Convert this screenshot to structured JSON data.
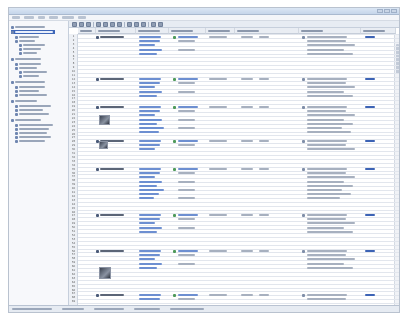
{
  "window": {
    "title": ""
  },
  "menu": {
    "items": [
      "",
      "",
      "",
      "",
      "",
      ""
    ]
  },
  "sidebar": {
    "items": [
      "",
      "",
      "",
      "",
      "",
      "",
      "",
      "",
      "",
      "",
      "",
      "",
      "",
      "",
      "",
      "",
      "",
      "",
      "",
      "",
      "",
      "",
      "",
      "",
      "",
      ""
    ]
  },
  "grid": {
    "columns": [
      "",
      "",
      "",
      "",
      "",
      "",
      "",
      ""
    ],
    "row_numbers": [
      "1",
      "2",
      "3",
      "4",
      "5",
      "6",
      "7",
      "8",
      "9",
      "10",
      "11",
      "12",
      "13",
      "14",
      "15",
      "16",
      "17",
      "18",
      "19",
      "20",
      "21",
      "22",
      "23",
      "24",
      "25",
      "26",
      "27",
      "28",
      "29",
      "30",
      "31",
      "32",
      "33",
      "34",
      "35",
      "36",
      "37",
      "38",
      "39",
      "40",
      "41",
      "42",
      "43",
      "44",
      "45",
      "46",
      "47",
      "48",
      "49",
      "50",
      "51",
      "52",
      "53",
      "54",
      "55",
      "56",
      "57",
      "58",
      "59",
      "60",
      "61",
      "62",
      "63",
      "64",
      "65",
      "66",
      "67",
      "68",
      "69",
      "70"
    ]
  },
  "status": {
    "segments": [
      "",
      "",
      "",
      "",
      ""
    ]
  },
  "colors": {
    "accent": "#3f67b8",
    "link": "#6d8fd1",
    "chrome": "#e6ebf2"
  },
  "icons": [
    "person-icon",
    "status-icon",
    "document-icon",
    "photo-thumbnail"
  ]
}
